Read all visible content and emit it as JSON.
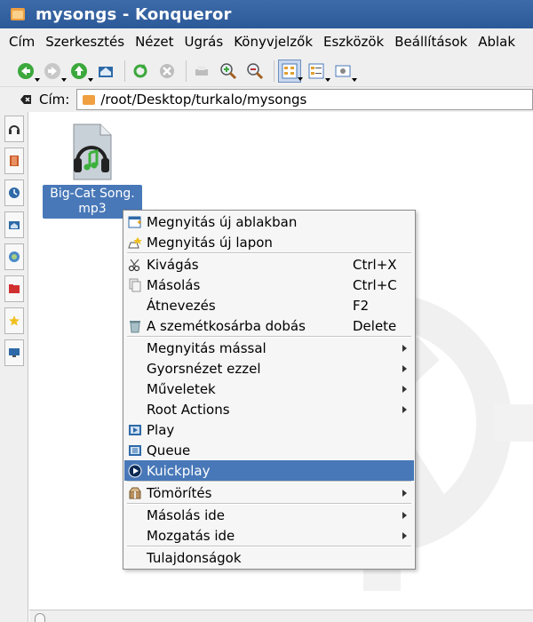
{
  "window": {
    "title": "mysongs - Konqueror"
  },
  "menubar": {
    "items": [
      {
        "label": "Cím"
      },
      {
        "label": "Szerkesztés"
      },
      {
        "label": "Nézet"
      },
      {
        "label": "Ugrás"
      },
      {
        "label": "Könyvjelzők"
      },
      {
        "label": "Eszközök"
      },
      {
        "label": "Beállítások"
      },
      {
        "label": "Ablak"
      }
    ]
  },
  "location": {
    "label": "Cím:",
    "path": "/root/Desktop/turkalo/mysongs"
  },
  "file": {
    "name_line1": "Big-Cat Song.",
    "name_line2": "mp3",
    "icon": "audio-file-icon"
  },
  "context_menu": {
    "items": [
      {
        "label": "Megnyitás új ablakban",
        "icon": "new-window-icon"
      },
      {
        "label": "Megnyitás új lapon",
        "icon": "new-tab-icon"
      },
      {
        "label": "Kivágás",
        "shortcut": "Ctrl+X",
        "icon": "scissors-icon"
      },
      {
        "label": "Másolás",
        "shortcut": "Ctrl+C",
        "icon": "copy-icon"
      },
      {
        "label": "Átnevezés",
        "shortcut": "F2"
      },
      {
        "label": "A szemétkosárba dobás",
        "shortcut": "Delete",
        "icon": "trash-icon"
      },
      {
        "label": "Megnyitás mással"
      },
      {
        "label": "Gyorsnézet ezzel"
      },
      {
        "label": "Műveletek"
      },
      {
        "label": "Root Actions"
      },
      {
        "label": "Play",
        "icon": "play-icon"
      },
      {
        "label": "Queue",
        "icon": "queue-icon"
      },
      {
        "label": "Kuickplay",
        "icon": "kuickplay-icon"
      },
      {
        "label": "Tömörítés",
        "icon": "archive-icon"
      },
      {
        "label": "Másolás ide"
      },
      {
        "label": "Mozgatás ide"
      },
      {
        "label": "Tulajdonságok"
      }
    ]
  },
  "colors": {
    "titlebar": "#2c5a99",
    "selection": "#4878b8",
    "menu_bg": "#f6f6f6",
    "chrome_bg": "#efefef"
  }
}
